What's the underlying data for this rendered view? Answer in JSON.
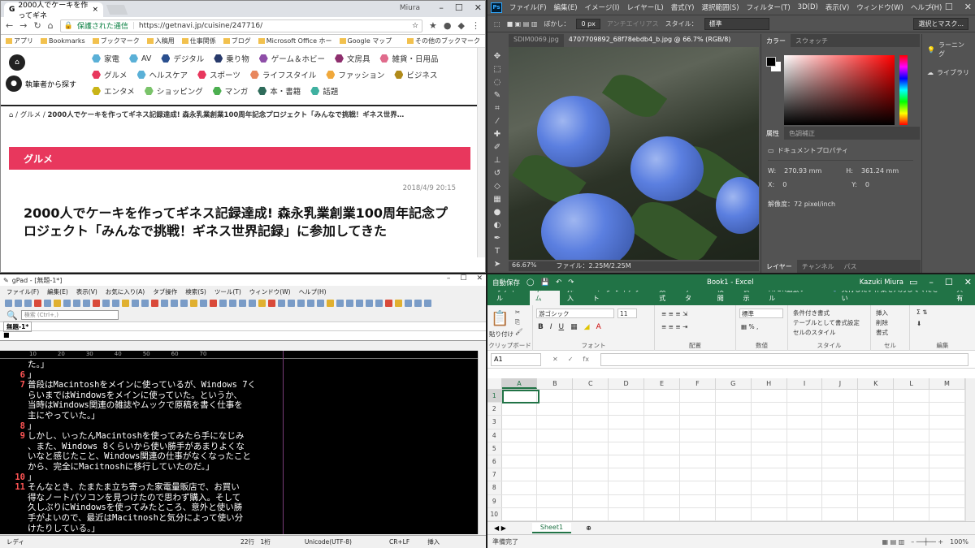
{
  "chrome": {
    "tab_title": "2000人でケーキを作ってギネ",
    "user": "Miura",
    "secure_label": "保護された通信",
    "url": "https://getnavi.jp/cuisine/247716/",
    "bookmarks": [
      "アプリ",
      "Bookmarks",
      "ブックマーク",
      "入稿用",
      "仕事関係",
      "ブログ",
      "Microsoft Office ホー",
      "Google マップ",
      "その他のブックマーク"
    ],
    "left_label": "執筆者から探す",
    "categories": [
      {
        "label": "家電",
        "color": "#5ab0d7"
      },
      {
        "label": "AV",
        "color": "#5ab0d7"
      },
      {
        "label": "デジタル",
        "color": "#2a4f8f"
      },
      {
        "label": "乗り物",
        "color": "#283a6b"
      },
      {
        "label": "ゲーム＆ホビー",
        "color": "#8e4ea8"
      },
      {
        "label": "文房具",
        "color": "#8e2f6e"
      },
      {
        "label": "雑貨・日用品",
        "color": "#e06b8c"
      },
      {
        "label": "グルメ",
        "color": "#e8375d"
      },
      {
        "label": "ヘルスケア",
        "color": "#5ab0d7"
      },
      {
        "label": "スポーツ",
        "color": "#e8375d"
      },
      {
        "label": "ライフスタイル",
        "color": "#e8875d"
      },
      {
        "label": "ファッション",
        "color": "#f0a83b"
      },
      {
        "label": "ビジネス",
        "color": "#b08a1a"
      },
      {
        "label": "エンタメ",
        "color": "#c9b417"
      },
      {
        "label": "ショッピング",
        "color": "#7ac36a"
      },
      {
        "label": "マンガ",
        "color": "#4caf50"
      },
      {
        "label": "本・書籍",
        "color": "#2e6b5a"
      },
      {
        "label": "話題",
        "color": "#3fb0a0"
      }
    ],
    "breadcrumb_section": "グルメ",
    "breadcrumb_title": "2000人でケーキを作ってギネス記録達成! 森永乳業創業100周年記念プロジェクト「みんなで挑戦！ギネス世界…",
    "category_banner": "グルメ",
    "date": "2018/4/9 20:15",
    "article_title": "2000人でケーキを作ってギネス記録達成! 森永乳業創業100周年記念プロジェクト「みんなで挑戦！ギネス世界記録」に参加してきた"
  },
  "photoshop": {
    "menu": [
      "ファイル(F)",
      "編集(E)",
      "イメージ(I)",
      "レイヤー(L)",
      "書式(Y)",
      "選択範囲(S)",
      "フィルター(T)",
      "3D(D)",
      "表示(V)",
      "ウィンドウ(W)",
      "ヘルプ(H)"
    ],
    "feather_label": "ぼかし：",
    "feather_value": "0 px",
    "antialias": "アンチエイリアス",
    "style_label": "スタイル：",
    "style_value": "標準",
    "select_mask": "選択とマスク...",
    "doc_tabs": [
      "SDIM0069.jpg",
      "4707709892_68f78ebdb4_b.jpg @ 66.7% (RGB/8)"
    ],
    "zoom": "66.67%",
    "file_info": "ファイル：2.25M/2.25M",
    "color_tabs": [
      "カラー",
      "スウォッチ"
    ],
    "props_tabs": [
      "属性",
      "色調補正"
    ],
    "doc_props": "ドキュメントプロパティ",
    "w_label": "W:",
    "w_value": "270.93 mm",
    "h_label": "H:",
    "h_value": "361.24 mm",
    "x_label": "X:",
    "x_value": "0",
    "y_label": "Y:",
    "y_value": "0",
    "resolution": "解像度：72 pixel/inch",
    "layer_tabs": [
      "レイヤー",
      "チャンネル",
      "パス"
    ],
    "learn": "ラーニング",
    "library": "ライブラリ"
  },
  "gpad": {
    "title": "gPad - [無題-1*]",
    "menu": [
      "ファイル(F)",
      "編集(E)",
      "表示(V)",
      "お気に入り(A)",
      "タブ操作",
      "検索(S)",
      "ツール(T)",
      "ウィンドウ(W)",
      "ヘルプ(H)"
    ],
    "search_placeholder": "検索 (Ctrl+,)",
    "doc_tab": "無題-1*",
    "ruler": [
      "10",
      "20",
      "30",
      "40",
      "50",
      "60",
      "70"
    ],
    "lines": [
      {
        "n": "",
        "t": "た。」"
      },
      {
        "n": "6",
        "t": "」"
      },
      {
        "n": "7",
        "t": "普段はMacintoshをメインに使っているが、Windows 7く"
      },
      {
        "n": "",
        "t": "らいまではWindowsをメインに使っていた。というか、"
      },
      {
        "n": "",
        "t": "当時はWindows関連の雑誌やムックで原稿を書く仕事を"
      },
      {
        "n": "",
        "t": "主にやっていた。」"
      },
      {
        "n": "8",
        "t": "」"
      },
      {
        "n": "9",
        "t": "しかし、いったんMacintoshを使ってみたら手になじみ"
      },
      {
        "n": "",
        "t": "、また、Windows 8くらいから使い勝手があまりよくな"
      },
      {
        "n": "",
        "t": "いなと感じたこと、Windows関連の仕事がなくなったこと"
      },
      {
        "n": "",
        "t": "から、完全にMacitnoshに移行していたのだ。」"
      },
      {
        "n": "10",
        "t": "」"
      },
      {
        "n": "11",
        "t": "そんなとき、たまたま立ち寄った家電量販店で、お買い"
      },
      {
        "n": "",
        "t": "得なノートパソコンを見つけたので思わず購入。そして"
      },
      {
        "n": "",
        "t": "久しぶりにWindowsを使ってみたところ、意外と使い勝"
      },
      {
        "n": "",
        "t": "手がよいので、最近はMacitnoshと気分によって使い分"
      },
      {
        "n": "",
        "t": "けたりしている。」"
      }
    ],
    "status_mode": "レディ",
    "status_pos": "22行　1桁",
    "status_enc": "Unicode(UTF-8)",
    "status_eol": "CR+LF",
    "status_ins": "挿入"
  },
  "excel": {
    "autosave": "自動保存",
    "title": "Book1 - Excel",
    "user": "Kazuki Miura",
    "tabs": [
      "ファイル",
      "ホーム",
      "挿入",
      "ページ レイアウト",
      "数式",
      "データ",
      "校閲",
      "表示",
      "ATOK拡張ツール"
    ],
    "tell_me": "実行したい作業を入力してください",
    "share": "共有",
    "paste": "貼り付け",
    "font_name": "游ゴシック",
    "font_size": "11",
    "number_format": "標準",
    "cond_fmt": "条件付き書式",
    "table_fmt": "テーブルとして書式設定",
    "cell_style": "セルのスタイル",
    "insert": "挿入",
    "delete": "削除",
    "format": "書式",
    "groups": [
      "クリップボード",
      "フォント",
      "配置",
      "数値",
      "スタイル",
      "セル",
      "編集"
    ],
    "name_box": "A1",
    "columns": [
      "A",
      "B",
      "C",
      "D",
      "E",
      "F",
      "G",
      "H",
      "I",
      "J",
      "K",
      "L",
      "M"
    ],
    "rows": [
      "1",
      "2",
      "3",
      "4",
      "5",
      "6",
      "7",
      "8",
      "9",
      "10"
    ],
    "sheet": "Sheet1",
    "status": "準備完了",
    "zoom": "100%"
  }
}
